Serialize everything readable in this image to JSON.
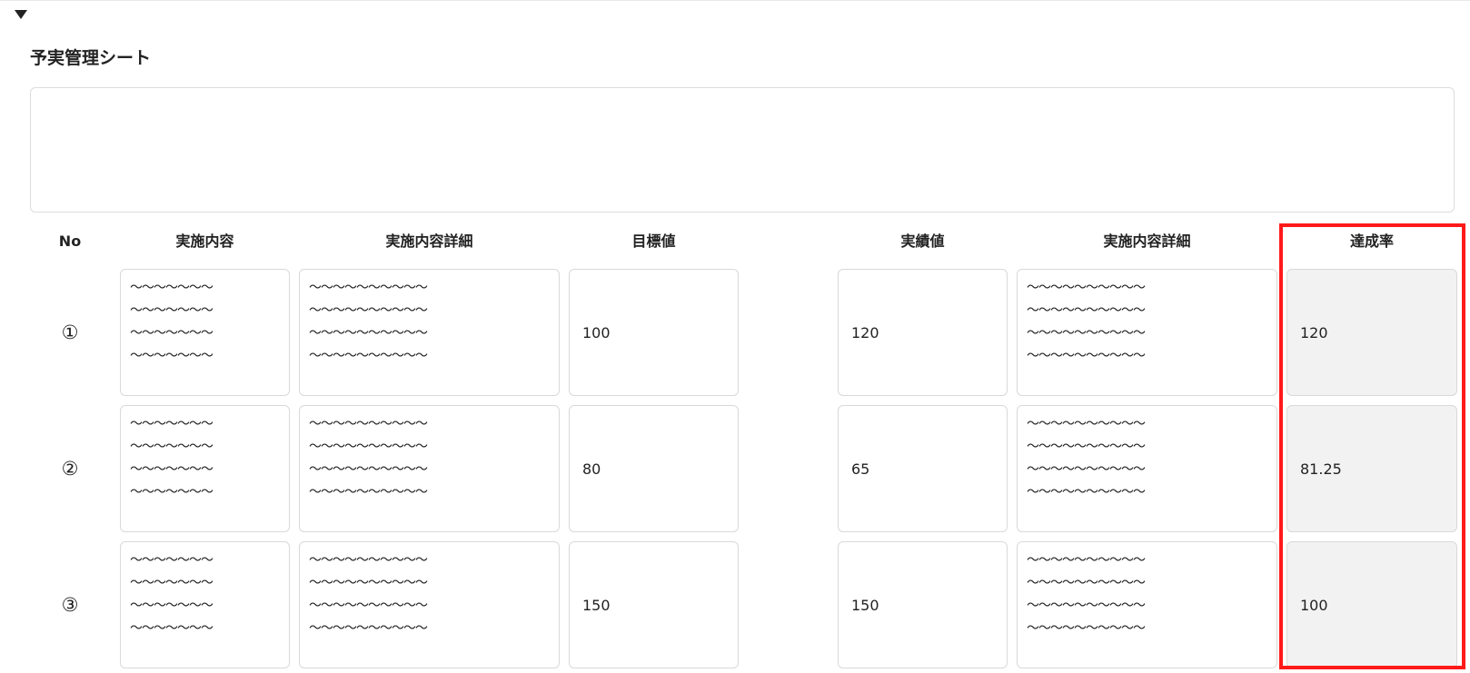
{
  "section": {
    "title": "予実管理シート",
    "memo": ""
  },
  "headers": {
    "no": "No",
    "content": "実施内容",
    "detail": "実施内容詳細",
    "target": "目標値",
    "actual": "実績値",
    "actual_detail": "実施内容詳細",
    "rate": "達成率"
  },
  "rows": [
    {
      "no": "①",
      "content": "〜〜〜〜〜〜〜\n〜〜〜〜〜〜〜\n〜〜〜〜〜〜〜\n〜〜〜〜〜〜〜",
      "detail": "〜〜〜〜〜〜〜〜〜〜\n〜〜〜〜〜〜〜〜〜〜\n〜〜〜〜〜〜〜〜〜〜\n〜〜〜〜〜〜〜〜〜〜",
      "target": "100",
      "actual": "120",
      "actual_detail": "〜〜〜〜〜〜〜〜〜〜\n〜〜〜〜〜〜〜〜〜〜\n〜〜〜〜〜〜〜〜〜〜\n〜〜〜〜〜〜〜〜〜〜",
      "rate": "120"
    },
    {
      "no": "②",
      "content": "〜〜〜〜〜〜〜\n〜〜〜〜〜〜〜\n〜〜〜〜〜〜〜\n〜〜〜〜〜〜〜",
      "detail": "〜〜〜〜〜〜〜〜〜〜\n〜〜〜〜〜〜〜〜〜〜\n〜〜〜〜〜〜〜〜〜〜\n〜〜〜〜〜〜〜〜〜〜",
      "target": "80",
      "actual": "65",
      "actual_detail": "〜〜〜〜〜〜〜〜〜〜\n〜〜〜〜〜〜〜〜〜〜\n〜〜〜〜〜〜〜〜〜〜\n〜〜〜〜〜〜〜〜〜〜",
      "rate": "81.25"
    },
    {
      "no": "③",
      "content": "〜〜〜〜〜〜〜\n〜〜〜〜〜〜〜\n〜〜〜〜〜〜〜\n〜〜〜〜〜〜〜",
      "detail": "〜〜〜〜〜〜〜〜〜〜\n〜〜〜〜〜〜〜〜〜〜\n〜〜〜〜〜〜〜〜〜〜\n〜〜〜〜〜〜〜〜〜〜",
      "target": "150",
      "actual": "150",
      "actual_detail": "〜〜〜〜〜〜〜〜〜〜\n〜〜〜〜〜〜〜〜〜〜\n〜〜〜〜〜〜〜〜〜〜\n〜〜〜〜〜〜〜〜〜〜",
      "rate": "100"
    }
  ],
  "colors": {
    "highlight": "#ff1a1a",
    "readonly_bg": "#f2f2f2",
    "border": "#d9d9d9"
  },
  "icons": {
    "toggle": "caret-down-icon"
  }
}
